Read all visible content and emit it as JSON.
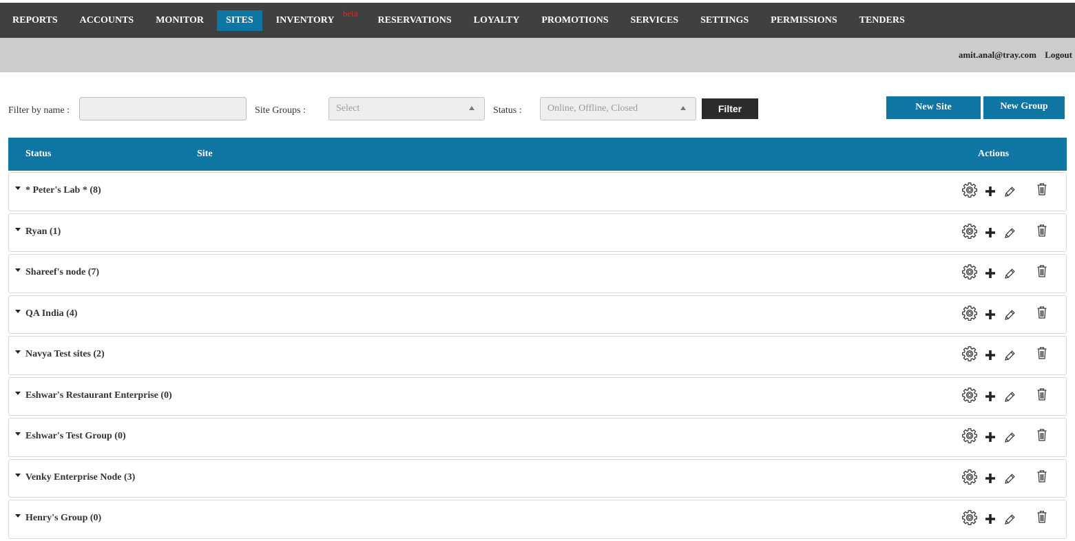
{
  "nav": {
    "items": [
      {
        "label": "REPORTS"
      },
      {
        "label": "ACCOUNTS"
      },
      {
        "label": "MONITOR"
      },
      {
        "label": "SITES"
      },
      {
        "label": "INVENTORY",
        "badge": "beta"
      },
      {
        "label": "RESERVATIONS"
      },
      {
        "label": "LOYALTY"
      },
      {
        "label": "PROMOTIONS"
      },
      {
        "label": "SERVICES"
      },
      {
        "label": "SETTINGS"
      },
      {
        "label": "PERMISSIONS"
      },
      {
        "label": "TENDERS"
      }
    ],
    "active": "SITES"
  },
  "user": {
    "email": "amit.anal@tray.com",
    "logout_label": "Logout"
  },
  "filters": {
    "name_label": "Filter by name :",
    "name_value": "",
    "groups_label": "Site Groups :",
    "groups_placeholder": "Select",
    "status_label": "Status :",
    "status_placeholder": "Online, Offline, Closed",
    "filter_label": "Filter",
    "new_site_label": "New Site",
    "new_group_label": "New Group"
  },
  "table": {
    "headers": {
      "status": "Status",
      "site": "Site",
      "actions": "Actions"
    },
    "groups": [
      {
        "name": "* Peter's Lab * (8)"
      },
      {
        "name": "Ryan (1)"
      },
      {
        "name": "Shareef's node (7)"
      },
      {
        "name": "QA India (4)"
      },
      {
        "name": "Navya Test sites (2)"
      },
      {
        "name": "Eshwar's Restaurant Enterprise (0)"
      },
      {
        "name": "Eshwar's Test Group (0)"
      },
      {
        "name": "Venky Enterprise Node (3)"
      },
      {
        "name": "Henry's Group (0)"
      }
    ]
  },
  "icons": {
    "row_actions": [
      "gear-icon",
      "plus-icon",
      "pencil-icon",
      "trash-icon"
    ],
    "expand": "caret-down-icon"
  },
  "colors": {
    "nav_bg": "#404040",
    "accent": "#0f76a3",
    "userbar_bg": "#cccccc",
    "beta": "#ff1a1a",
    "filter_btn": "#2b2b2b"
  }
}
